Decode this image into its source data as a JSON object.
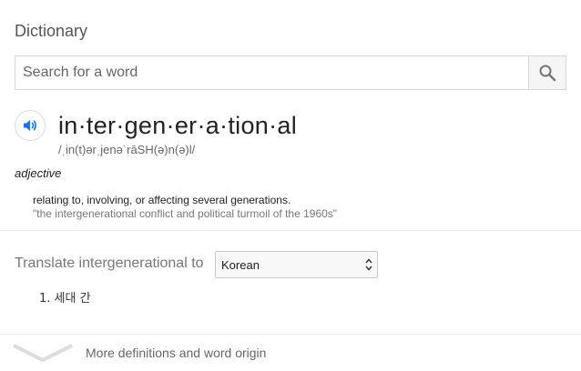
{
  "header": {
    "title": "Dictionary"
  },
  "search": {
    "placeholder": "Search for a word",
    "value": ""
  },
  "entry": {
    "headword": "in·ter·gen·er·a·tion·al",
    "phonetic": "/ˌin(t)ərˌjenəˈrāSH(ə)n(ə)l/",
    "part_of_speech": "adjective",
    "definition": "relating to, involving, or affecting several generations.",
    "example": "\"the intergenerational conflict and political turmoil of the 1960s\""
  },
  "translate": {
    "label": "Translate intergenerational to",
    "selected_language": "Korean",
    "results": [
      "1. 세대 간"
    ]
  },
  "footer": {
    "more_label": "More definitions and word origin"
  },
  "colors": {
    "accent": "#1a73e8",
    "icon_gray": "#757575"
  },
  "icons": {
    "search": "search-icon",
    "audio": "speaker-icon",
    "select": "updown-arrows-icon",
    "more": "chevron-down-icon"
  }
}
